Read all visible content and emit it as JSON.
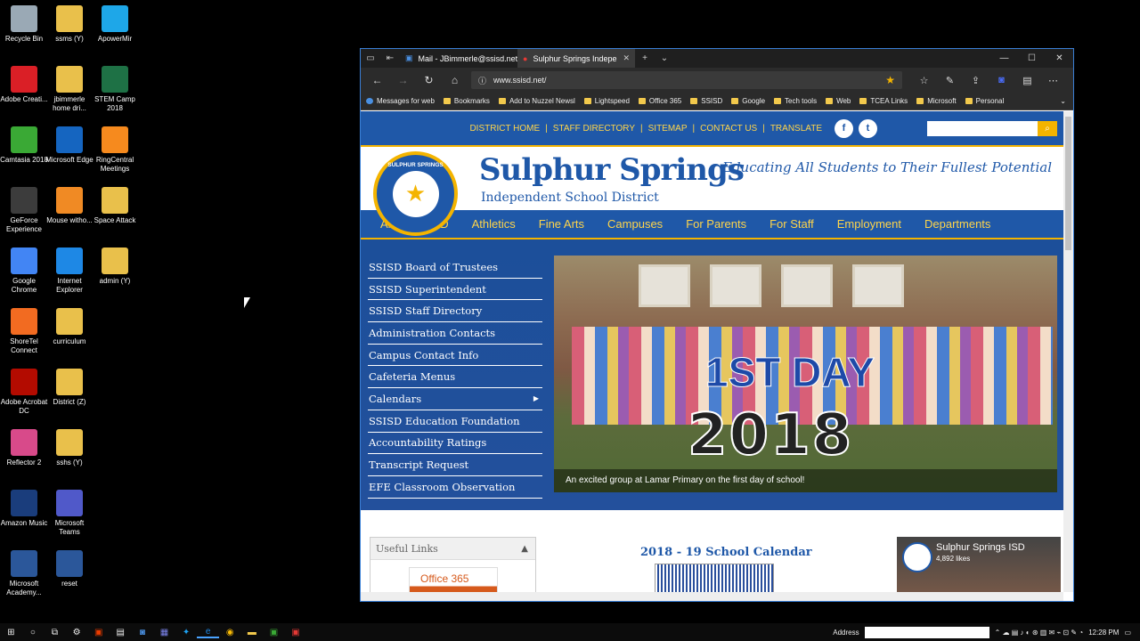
{
  "desktop": {
    "icons": [
      {
        "label": "Recycle Bin",
        "icon": "recycle-bin-icon",
        "color": "#9aa9b5"
      },
      {
        "label": "ssms (Y)",
        "icon": "folder-icon",
        "color": "#e9c04b"
      },
      {
        "label": "ApowerMir",
        "icon": "apowermirror-icon",
        "color": "#1ea7e8"
      },
      {
        "label": "Adobe Creati...",
        "icon": "adobe-cc-icon",
        "color": "#da1f26"
      },
      {
        "label": "jbimmerle home dri...",
        "icon": "folder-icon",
        "color": "#e9c04b"
      },
      {
        "label": "STEM Camp 2018",
        "icon": "excel-icon",
        "color": "#1e7145"
      },
      {
        "label": "Camtasia 2018",
        "icon": "camtasia-icon",
        "color": "#3aa935"
      },
      {
        "label": "Microsoft Edge",
        "icon": "edge-icon",
        "color": "#1565c0"
      },
      {
        "label": "RingCentral Meetings",
        "icon": "ringcentral-icon",
        "color": "#f68a1e"
      },
      {
        "label": "GeForce Experience",
        "icon": "geforce-icon",
        "color": "#3c3c3c"
      },
      {
        "label": "Mouse witho...",
        "icon": "mouse-without-borders-icon",
        "color": "#f08a24"
      },
      {
        "label": "Space Attack",
        "icon": "file-icon",
        "color": "#e9c04b"
      },
      {
        "label": "Google Chrome",
        "icon": "chrome-icon",
        "color": "#4285f4"
      },
      {
        "label": "Internet Explorer",
        "icon": "ie-icon",
        "color": "#1e88e5"
      },
      {
        "label": "admin (Y)",
        "icon": "folder-icon",
        "color": "#e9c04b"
      },
      {
        "label": "ShoreTel Connect",
        "icon": "shoretel-icon",
        "color": "#f26b21"
      },
      {
        "label": "curriculum",
        "icon": "folder-icon",
        "color": "#e9c04b"
      },
      {
        "label": "Adobe Acrobat DC",
        "icon": "acrobat-icon",
        "color": "#b30b00"
      },
      {
        "label": "District (Z)",
        "icon": "folder-icon",
        "color": "#e9c04b"
      },
      {
        "label": "Reflector 2",
        "icon": "reflector-icon",
        "color": "#d84a8a"
      },
      {
        "label": "sshs (Y)",
        "icon": "folder-icon",
        "color": "#e9c04b"
      },
      {
        "label": "Amazon Music",
        "icon": "amazon-music-icon",
        "color": "#1a3d7c"
      },
      {
        "label": "Microsoft Teams",
        "icon": "teams-icon",
        "color": "#5059c9"
      },
      {
        "label": "Microsoft Academy...",
        "icon": "word-icon",
        "color": "#2b579a"
      },
      {
        "label": "reset",
        "icon": "word-icon",
        "color": "#2b579a"
      }
    ]
  },
  "browser": {
    "tabs": [
      {
        "label": "Mail - JBimmerle@ssisd.net",
        "active": false
      },
      {
        "label": "Sulphur Springs Indepe",
        "active": true
      }
    ],
    "url": "www.ssisd.net/",
    "favorites": [
      "Messages for web",
      "Bookmarks",
      "Add to Nuzzel Newsl",
      "Lightspeed",
      "Office 365",
      "SSISD",
      "Google",
      "Tech tools",
      "Web",
      "TCEA Links",
      "Microsoft",
      "Personal"
    ]
  },
  "site": {
    "toplinks": [
      "DISTRICT HOME",
      "STAFF DIRECTORY",
      "SITEMAP",
      "CONTACT US",
      "TRANSLATE"
    ],
    "social": {
      "facebook": "f",
      "twitter": "t"
    },
    "seal_text": "SULPHUR SPRINGS",
    "title": "Sulphur Springs",
    "subtitle": "Independent School District",
    "tagline": "Educating All Students to Their Fullest Potential",
    "mainnav": [
      "About SSISD",
      "Athletics",
      "Fine Arts",
      "Campuses",
      "For Parents",
      "For Staff",
      "Employment",
      "Departments"
    ],
    "sidemenu": [
      "SSISD Board of Trustees",
      "SSISD Superintendent",
      "SSISD Staff Directory",
      "Administration Contacts",
      "Campus Contact Info",
      "Cafeteria Menus",
      "Calendars",
      "SSISD Education Foundation",
      "Accountability Ratings",
      "Transcript Request",
      "EFE Classroom Observation"
    ],
    "photo": {
      "big_text": "2018",
      "sign_text": "1ST DAY",
      "caption": "An excited group at Lamar Primary on the first day of school!"
    },
    "useful_links": "Useful Links",
    "office365": "Office 365",
    "calendar_title": "2018 - 19 School Calendar",
    "facebook_widget": {
      "name": "Sulphur Springs ISD",
      "likes": "4,892 likes"
    },
    "colors": {
      "brand_blue": "#1f58a8",
      "gold": "#f4b400"
    }
  },
  "taskbar": {
    "address_label": "Address",
    "time": "12:28 PM"
  }
}
